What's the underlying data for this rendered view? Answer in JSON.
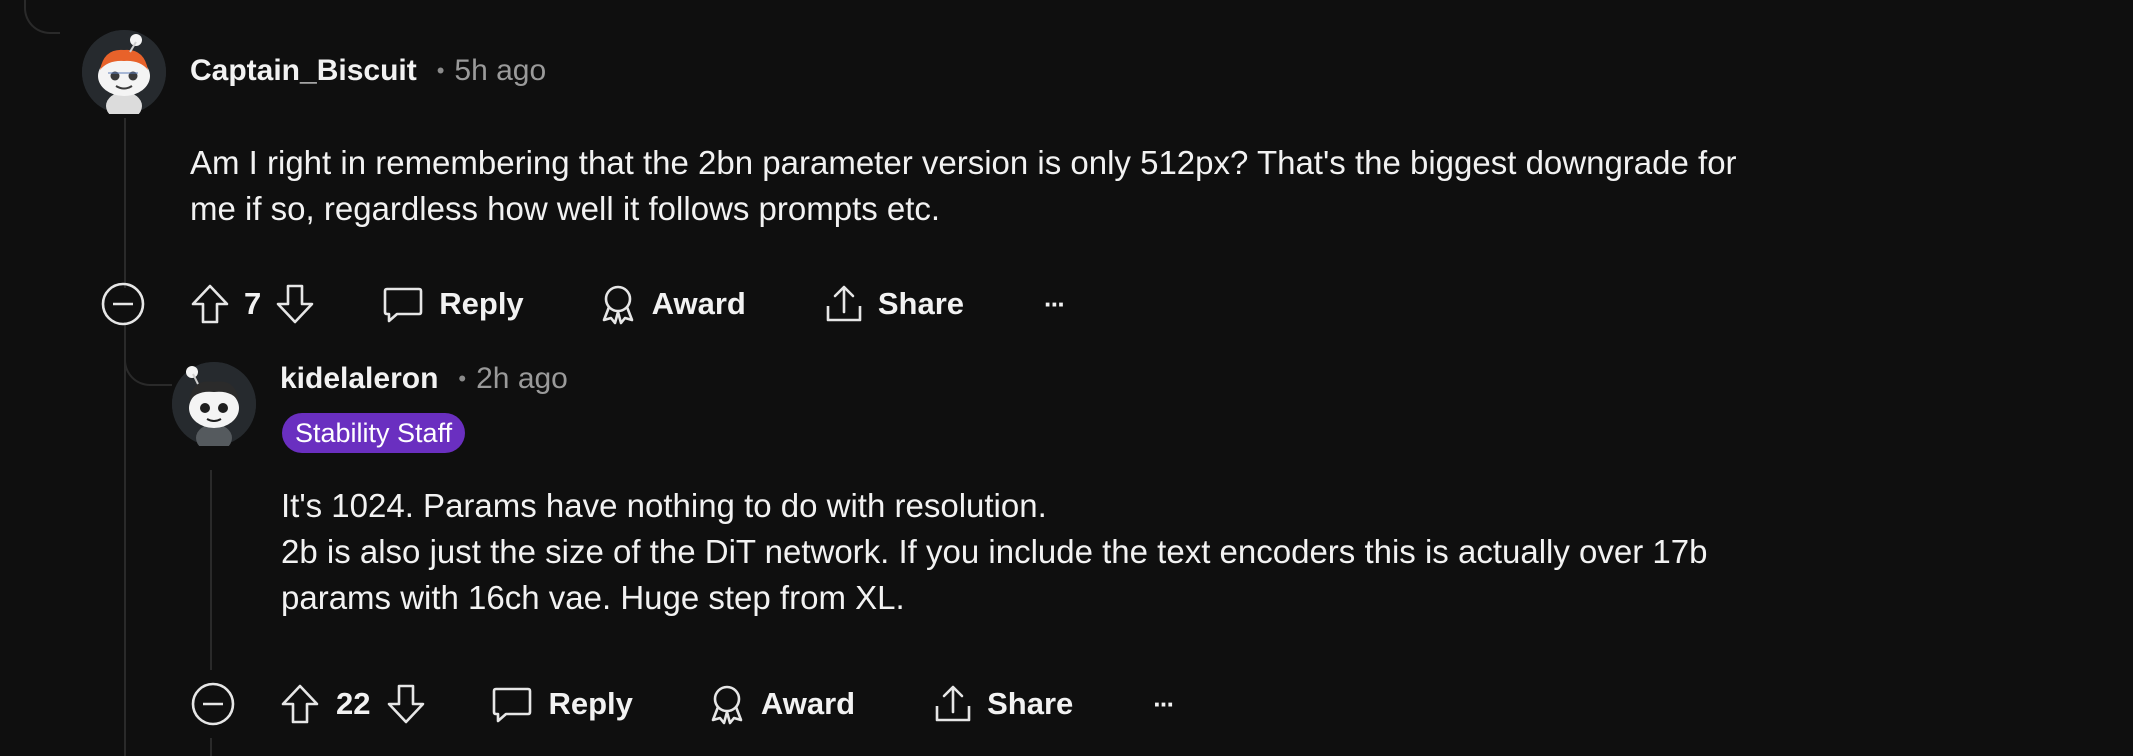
{
  "comments": [
    {
      "username": "Captain_Biscuit",
      "separator": "•",
      "timestamp": "5h ago",
      "body": "Am I right in remembering that the 2bn parameter version is only 512px? That's the biggest downgrade for\nme if so, regardless how well it follows prompts etc.",
      "votes": "7",
      "reply_label": "Reply",
      "award_label": "Award",
      "share_label": "Share",
      "more_label": "···"
    },
    {
      "username": "kidelaleron",
      "separator": "•",
      "timestamp": "2h ago",
      "flair": "Stability Staff",
      "body": "It's 1024. Params have nothing to do with resolution.\n2b is also just the size of the DiT network. If you include the text encoders this is actually over 17b\nparams with 16ch vae. Huge step from XL.",
      "votes": "22",
      "reply_label": "Reply",
      "award_label": "Award",
      "share_label": "Share",
      "more_label": "···"
    }
  ],
  "colors": {
    "background": "#0f0f0f",
    "text": "#f2f2f2",
    "muted": "#9a9a9a",
    "thread_line": "#2a2a2a",
    "flair_bg": "#6a2fc0"
  }
}
